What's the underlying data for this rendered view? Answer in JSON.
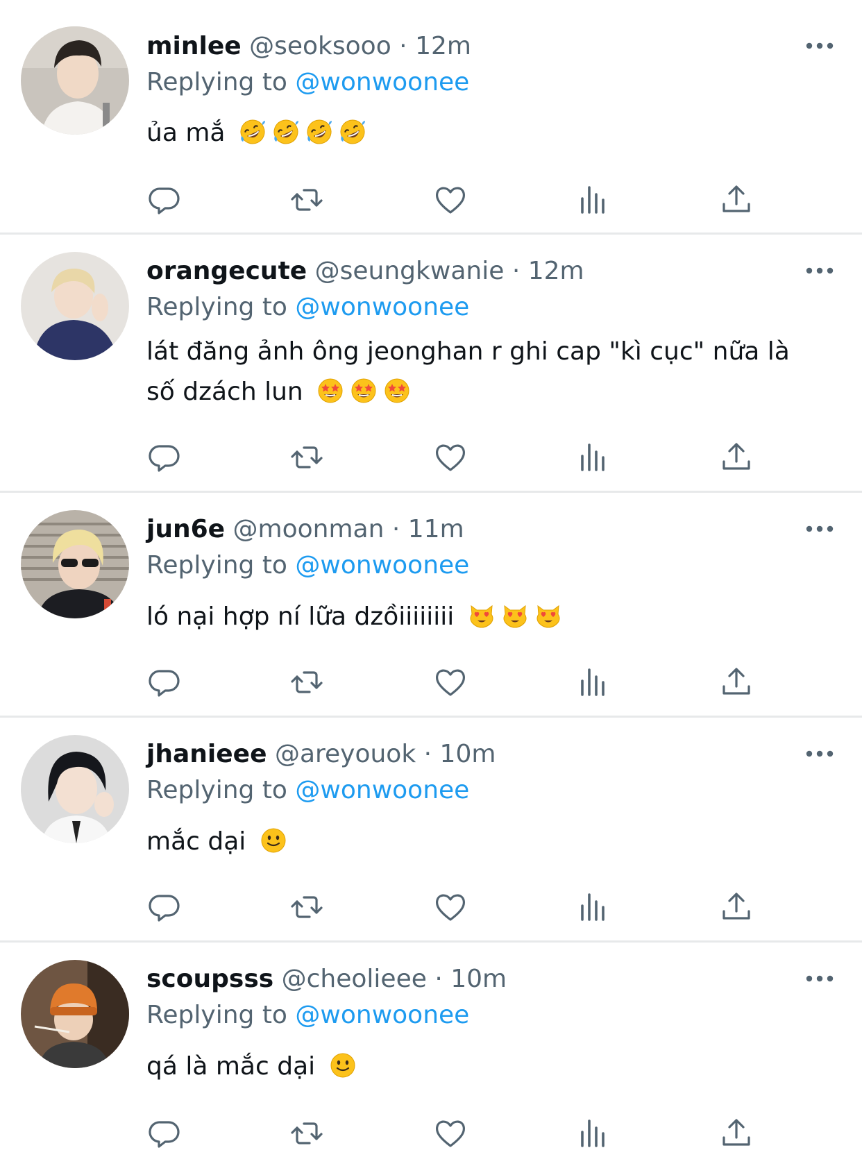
{
  "colors": {
    "text": "#0f1419",
    "muted": "#536471",
    "mention": "#1d9bf0",
    "divider": "#e7e9ea"
  },
  "reply_label": "Replying to",
  "tweets": [
    {
      "name": "minlee",
      "handle": "@seoksooo",
      "separator": "·",
      "time": "12m",
      "reply_to": "@wonwoonee",
      "text": "ủa mắ",
      "emoji": "rolling-on-floor-laughing-emoji",
      "emoji_count": 4
    },
    {
      "name": "orangecute",
      "handle": "@seungkwanie",
      "separator": "·",
      "time": "12m",
      "reply_to": "@wonwoonee",
      "text_line1": "lát đăng ảnh ông jeonghan r ghi cap \"kì cục\" nữa là",
      "text_line2": "số dzách lun",
      "emoji": "star-struck-emoji",
      "emoji_count": 3
    },
    {
      "name": "jun6e",
      "handle": "@moonman",
      "separator": "·",
      "time": "11m",
      "reply_to": "@wonwoonee",
      "text": "ló nại hợp ní lữa dzồiiiiiiii",
      "emoji": "heart-eyes-cat-emoji",
      "emoji_count": 3
    },
    {
      "name": "jhanieee",
      "handle": "@areyouok",
      "separator": "·",
      "time": "10m",
      "reply_to": "@wonwoonee",
      "text": "mắc dại",
      "emoji": "slightly-smiling-face-emoji",
      "emoji_count": 1
    },
    {
      "name": "scoupsss",
      "handle": "@cheolieee",
      "separator": "·",
      "time": "10m",
      "reply_to": "@wonwoonee",
      "text": "qá là mắc dại",
      "emoji": "slightly-smiling-face-emoji",
      "emoji_count": 1
    }
  ],
  "action_icons": [
    "reply-icon",
    "retweet-icon",
    "like-icon",
    "views-icon",
    "share-icon"
  ],
  "more_icon": "more-options-icon"
}
